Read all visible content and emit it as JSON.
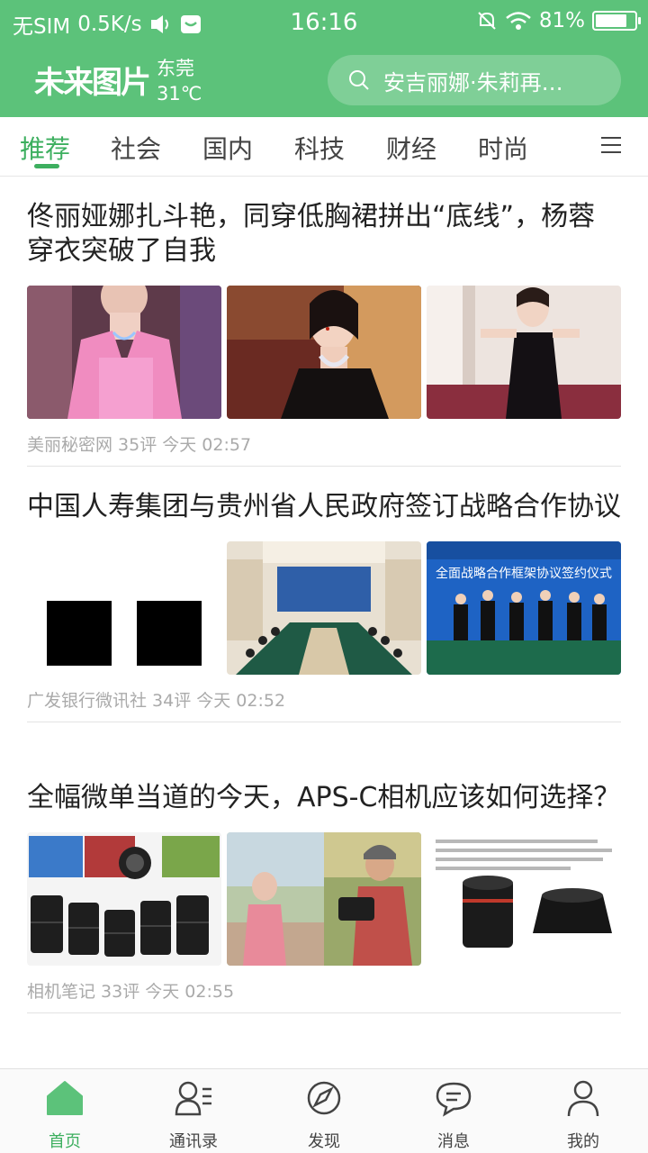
{
  "status": {
    "carrier": "无SIM",
    "speed": "0.5K/s",
    "time": "16:16",
    "battery": "81%",
    "battery_level": 0.81
  },
  "header": {
    "logo": "未来图片",
    "city": "东莞",
    "temp": "31℃",
    "search_placeholder": "安吉丽娜·朱莉再…"
  },
  "tabs": [
    "推荐",
    "社会",
    "国内",
    "科技",
    "财经",
    "时尚"
  ],
  "articles": [
    {
      "title": "佟丽娅娜扎斗艳，同穿低胸裙拼出“底线”，杨蓉穿衣突破了自我",
      "meta": "美丽秘密网 35评 今天 02:57"
    },
    {
      "title": "中国人寿集团与贵州省人民政府签订战略合作协议",
      "meta": "广发银行微讯社 34评 今天 02:52",
      "banner_text": "全面战略合作框架协议签约仪式"
    },
    {
      "title": "全幅微单当道的今天，APS-C相机应该如何选择？",
      "meta": "相机笔记 33评 今天 02:55"
    }
  ],
  "bottom_nav": [
    "首页",
    "通讯录",
    "发现",
    "消息",
    "我的"
  ],
  "colors": {
    "accent": "#5cc27a",
    "accent_text": "#3daf5f"
  }
}
